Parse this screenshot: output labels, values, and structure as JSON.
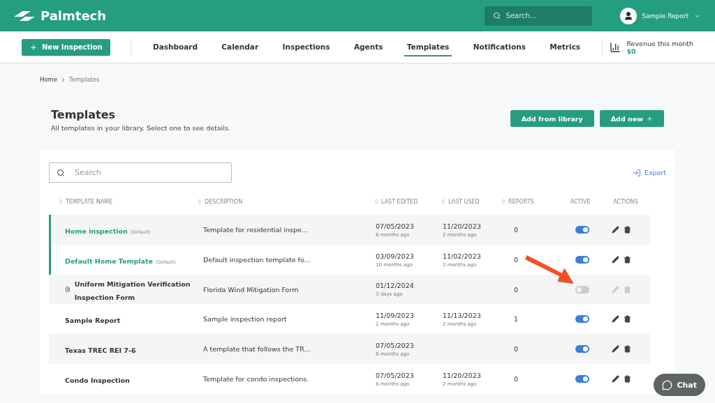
{
  "header": {
    "brand": "Palmtech",
    "search": {
      "placeholder": "Search..."
    },
    "user": "Sample Report"
  },
  "nav": {
    "new_button": "New Inspection",
    "items": [
      {
        "label": "Dashboard",
        "selected": false
      },
      {
        "label": "Calendar",
        "selected": false
      },
      {
        "label": "Inspections",
        "selected": false
      },
      {
        "label": "Agents",
        "selected": false
      },
      {
        "label": "Templates",
        "selected": true
      },
      {
        "label": "Notifications",
        "selected": false
      },
      {
        "label": "Metrics",
        "selected": false
      }
    ],
    "revenue": {
      "label": "Revenue this month",
      "value": "$0"
    }
  },
  "breadcrumb": [
    "Home",
    "Templates"
  ],
  "page": {
    "title": "Templates",
    "subtitle": "All templates in your library. Select one to see details.",
    "buttons": [
      {
        "label": "Add from library",
        "plus": false
      },
      {
        "label": "Add new",
        "plus": true
      }
    ]
  },
  "table": {
    "search": {
      "placeholder": "Search"
    },
    "export": "Export",
    "columns": [
      {
        "label": "TEMPLATE NAME",
        "sortable": true
      },
      {
        "label": "DESCRIPTION",
        "sortable": true
      },
      {
        "label": "LAST EDITED",
        "sortable": true
      },
      {
        "label": "LAST USED",
        "sortable": true
      },
      {
        "label": "REPORTS",
        "sortable": true
      },
      {
        "label": "ACTIVE",
        "sortable": false
      },
      {
        "label": "ACTIONS",
        "sortable": false
      }
    ],
    "rows": [
      {
        "kind": "default",
        "name": "Home inspection",
        "tag": "(Default)",
        "description": "Template for residential inspe...",
        "edited": "07/05/2023",
        "edited_ago": "6 months ago",
        "used": "11/20/2023",
        "used_ago": "2 months ago",
        "reports": "0",
        "active": true
      },
      {
        "kind": "default",
        "name": "Default Home Template",
        "tag": "(Default)",
        "description": "Default inspection template fo...",
        "edited": "03/09/2023",
        "edited_ago": "10 months ago",
        "used": "11/02/2023",
        "used_ago": "2 months ago",
        "reports": "0",
        "active": true
      },
      {
        "kind": "pdf",
        "name": "Uniform Mitigation Verification Inspection Form",
        "description": "Florida Wind Mitigation Form",
        "edited": "01/12/2024",
        "edited_ago": "3 days ago",
        "reports": "0",
        "active": false
      },
      {
        "kind": "plain",
        "name": "Sample Report",
        "description": "Sample inspection report",
        "edited": "11/09/2023",
        "edited_ago": "2 months ago",
        "used": "11/13/2023",
        "used_ago": "2 months ago",
        "reports": "1",
        "active": true
      },
      {
        "kind": "plain",
        "name": "Texas TREC REI 7-6",
        "description": "A template that follows the TR...",
        "edited": "07/05/2023",
        "edited_ago": "6 months ago",
        "reports": "0",
        "active": true
      },
      {
        "kind": "plain",
        "name": "Condo Inspection",
        "description": "Template for condo inspections.",
        "edited": "07/05/2023",
        "edited_ago": "6 months ago",
        "used": "11/20/2023",
        "used_ago": "2 months ago",
        "reports": "0",
        "active": true
      }
    ]
  },
  "chat": {
    "label": "Chat"
  }
}
